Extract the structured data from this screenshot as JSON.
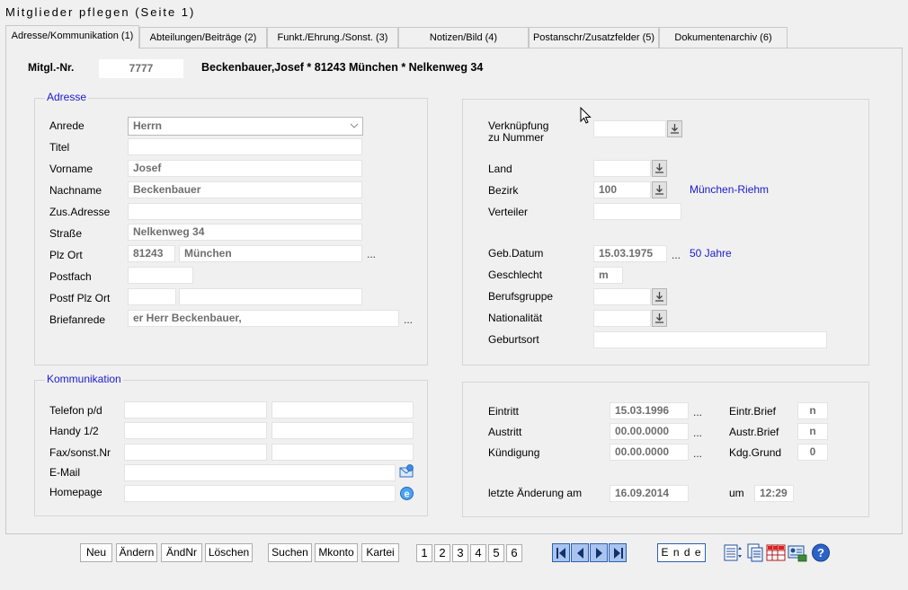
{
  "window": {
    "title": "Mitglieder pflegen (Seite 1)"
  },
  "tabs": [
    "Adresse/Kommunikation (1)",
    "Abteilungen/Beiträge (2)",
    "Funkt./Ehrung./Sonst. (3)",
    "Notizen/Bild  (4)",
    "Postanschr/Zusatzfelder (5)",
    "Dokumentenarchiv (6)"
  ],
  "header": {
    "member_no_label": "Mitgl.-Nr.",
    "member_no": "7777",
    "summary": "Beckenbauer,Josef * 81243 München * Nelkenweg 34"
  },
  "address": {
    "legend": "Adresse",
    "anrede_label": "Anrede",
    "anrede": "Herrn",
    "titel_label": "Titel",
    "titel": "",
    "vorname_label": "Vorname",
    "vorname": "Josef",
    "nachname_label": "Nachname",
    "nachname": "Beckenbauer",
    "zusadresse_label": "Zus.Adresse",
    "zusadresse": "",
    "strasse_label": "Straße",
    "strasse": "Nelkenweg 34",
    "plzort_label": "Plz  Ort",
    "plz": "81243",
    "ort": "München",
    "postfach_label": "Postfach",
    "postfach": "",
    "postfplzort_label": "Postf  Plz Ort",
    "postf_plz": "",
    "postf_ort": "",
    "briefanrede_label": "Briefanrede",
    "briefanrede": "er Herr Beckenbauer,"
  },
  "details": {
    "verknuepfung_label_1": "Verknüpfung",
    "verknuepfung_label_2": "zu Nummer",
    "verknuepfung": "",
    "land_label": "Land",
    "land": "",
    "bezirk_label": "Bezirk",
    "bezirk": "100",
    "bezirk_name": "München-Riehm",
    "verteiler_label": "Verteiler",
    "verteiler": "",
    "gebdatum_label": "Geb.Datum",
    "gebdatum": "15.03.1975",
    "alter": "50 Jahre",
    "geschlecht_label": "Geschlecht",
    "geschlecht": "m",
    "berufsgruppe_label": "Berufsgruppe",
    "berufsgruppe": "",
    "nationalitaet_label": "Nationalität",
    "nationalitaet": "",
    "geburtsort_label": "Geburtsort",
    "geburtsort": ""
  },
  "communication": {
    "legend": "Kommunikation",
    "telefon_label": "Telefon p/d",
    "handy_label": "Handy 1/2",
    "fax_label": "Fax/sonst.Nr",
    "email_label": "E-Mail",
    "homepage_label": "Homepage"
  },
  "membership": {
    "eintritt_label": "Eintritt",
    "eintritt": "15.03.1996",
    "austritt_label": "Austritt",
    "austritt": "00.00.0000",
    "kuendigung_label": "Kündigung",
    "kuendigung": "00.00.0000",
    "eintr_brief_label": "Eintr.Brief",
    "eintr_brief": "n",
    "austr_brief_label": "Austr.Brief",
    "austr_brief": "n",
    "kdg_grund_label": "Kdg.Grund",
    "kdg_grund": "0",
    "last_change_label": "letzte Änderung am",
    "last_change": "16.09.2014",
    "um_label": "um",
    "um": "12:29"
  },
  "toolbar": {
    "neu": "Neu",
    "aendern": "Ändern",
    "aendnr": "ÄndNr",
    "loeschen": "Löschen",
    "suchen": "Suchen",
    "mkonto": "Mkonto",
    "kartei": "Kartei",
    "pages": [
      "1",
      "2",
      "3",
      "4",
      "5",
      "6"
    ],
    "ende": "E n d e"
  },
  "icons": {
    "dots": "...",
    "accent_blue": "#1a1ad0"
  }
}
